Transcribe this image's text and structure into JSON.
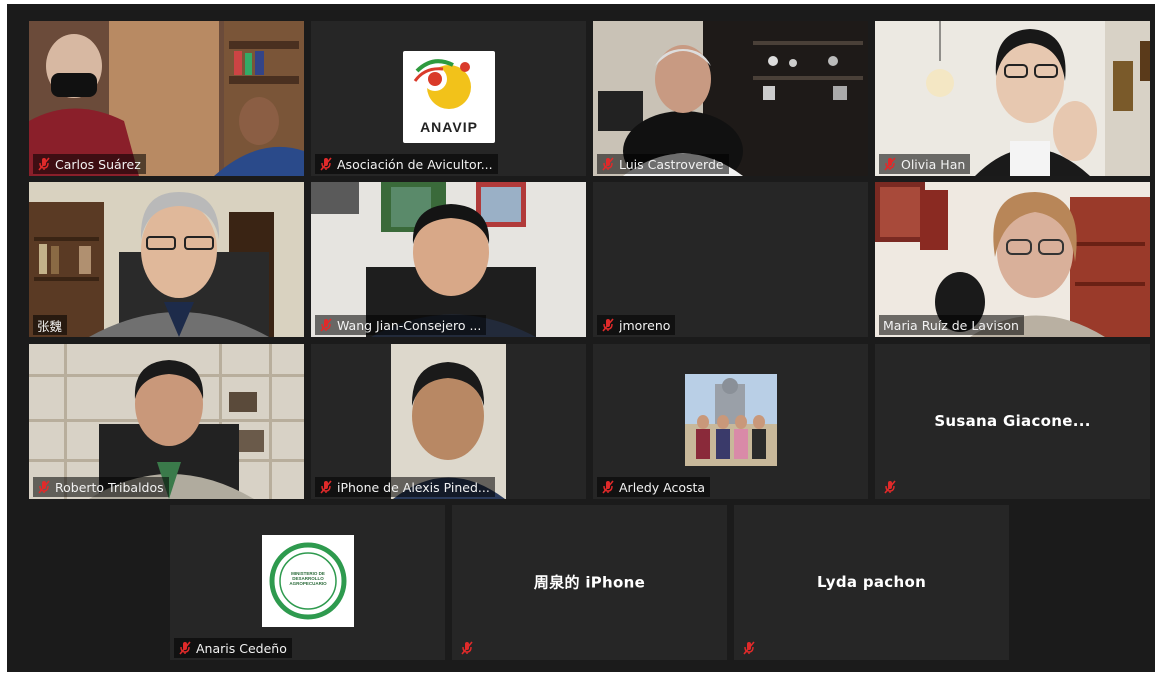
{
  "meeting": {
    "participants": [
      {
        "name": "Carlos Suárez",
        "muted": true
      },
      {
        "name": "Asociación de Avicultor...",
        "muted": true,
        "logo_text": "ANAVIP"
      },
      {
        "name": "Luis Castroverde",
        "muted": true
      },
      {
        "name": "Olivia Han",
        "muted": true
      },
      {
        "name": "张魏",
        "muted": false,
        "active_speaker": true
      },
      {
        "name": "Wang Jian-Consejero ...",
        "muted": true
      },
      {
        "name": "jmoreno",
        "muted": true
      },
      {
        "name": "Maria Ruíz de Lavison",
        "muted": false
      },
      {
        "name": "Roberto Tribaldos",
        "muted": true
      },
      {
        "name": "iPhone de Alexis Pined...",
        "muted": true
      },
      {
        "name": "Arledy Acosta",
        "muted": true
      },
      {
        "name": "Susana Giacone...",
        "muted": true,
        "camera_off": true
      },
      {
        "name": "Anaris Cedeño",
        "muted": true,
        "logo_text": "MINISTERIO DE DESARROLLO AGROPECUARIO"
      },
      {
        "name": "周泉的 iPhone",
        "muted": true,
        "camera_off": true
      },
      {
        "name": "Lyda pachon",
        "muted": true,
        "camera_off": true
      }
    ]
  },
  "colors": {
    "background": "#1b1b1b",
    "tile": "#262626",
    "active_speaker_border": "#d8df3a",
    "mic_muted": "#e02a2a"
  },
  "icons": {
    "muted": "mic-muted-icon"
  }
}
